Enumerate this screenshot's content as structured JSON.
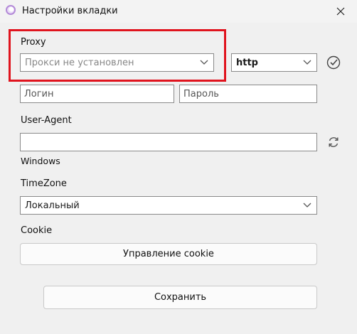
{
  "window": {
    "title": "Настройки вкладки",
    "app_icon": "app-logo-icon",
    "close_icon": "close-icon"
  },
  "proxy": {
    "label": "Proxy",
    "selected": "Прокси не установлен",
    "protocol": "http",
    "check_icon": "check-circle-icon",
    "login_placeholder": "Логин",
    "password_placeholder": "Пароль"
  },
  "user_agent": {
    "label": "User-Agent",
    "value": "",
    "os_label": "Windows",
    "refresh_icon": "refresh-icon"
  },
  "timezone": {
    "label": "TimeZone",
    "selected": "Локальный"
  },
  "cookie": {
    "label": "Cookie",
    "manage_button": "Управление cookie"
  },
  "footer": {
    "save_button": "Сохранить"
  },
  "colors": {
    "highlight": "#e0141e",
    "background": "#f0f0f0"
  }
}
